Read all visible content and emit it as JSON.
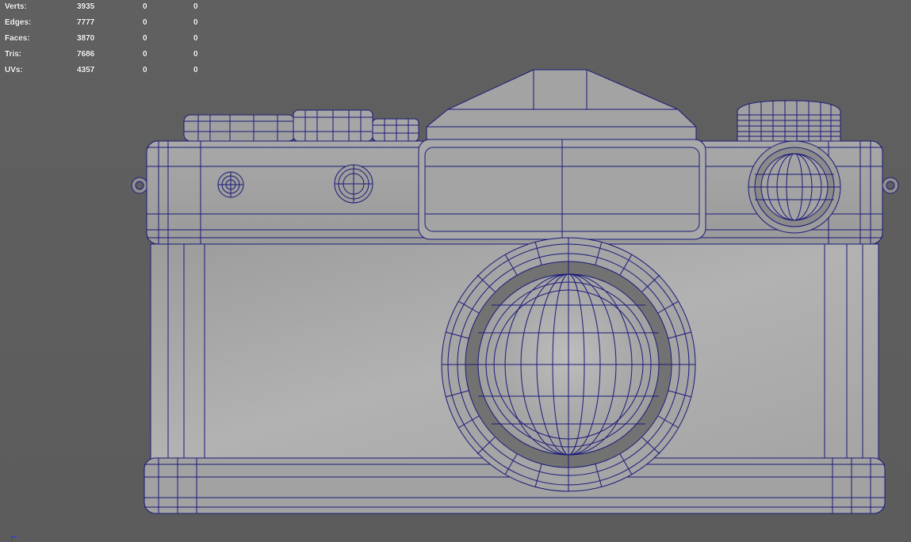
{
  "viewport": {
    "wire_color": "#1a1a7a",
    "shade_light": "#a6a6a6",
    "shade_mid": "#8f8f8f",
    "shade_dark": "#6e6e6e",
    "background": "#5f5f5f"
  },
  "hud": {
    "rows": [
      {
        "label": "Verts:",
        "v1": "3935",
        "v2": "0",
        "v3": "0"
      },
      {
        "label": "Edges:",
        "v1": "7777",
        "v2": "0",
        "v3": "0"
      },
      {
        "label": "Faces:",
        "v1": "3870",
        "v2": "0",
        "v3": "0"
      },
      {
        "label": "Tris:",
        "v1": "7686",
        "v2": "0",
        "v3": "0"
      },
      {
        "label": "UVs:",
        "v1": "4357",
        "v2": "0",
        "v3": "0"
      }
    ]
  }
}
